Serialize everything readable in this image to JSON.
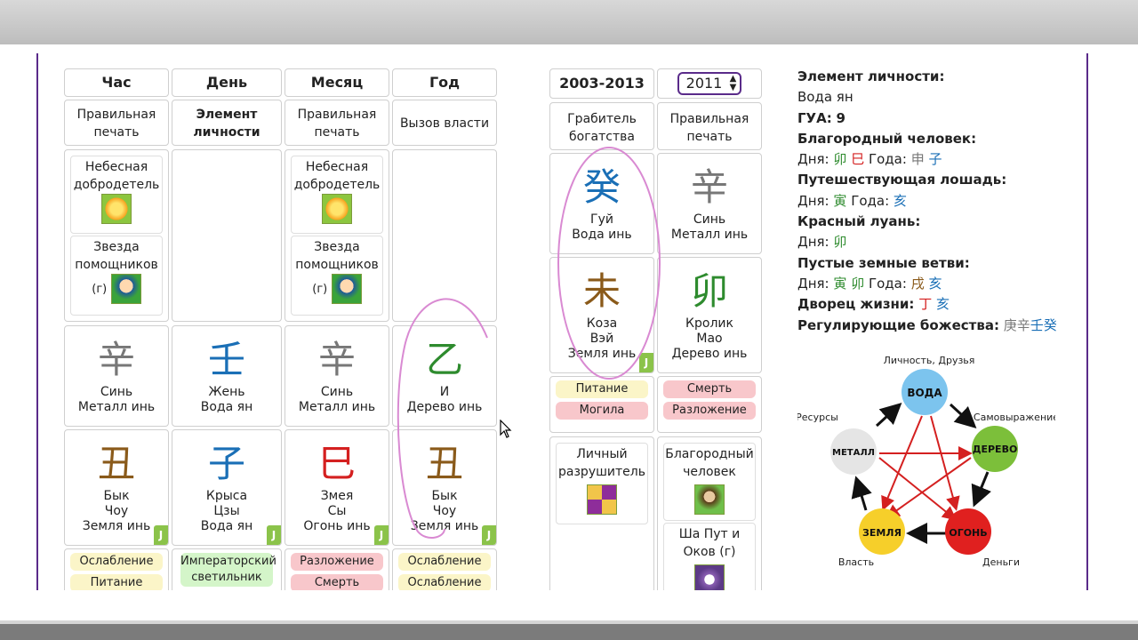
{
  "columns_left": [
    {
      "label": "Час",
      "sub": "Правильная печать",
      "sub_bold": false
    },
    {
      "label": "День",
      "sub": "Элемент личности",
      "sub_bold": true
    },
    {
      "label": "Месяц",
      "sub": "Правильная печать",
      "sub_bold": false
    },
    {
      "label": "Год",
      "sub": "Вызов власти",
      "sub_bold": false
    }
  ],
  "stars": {
    "heavenly": "Небесная добродетель",
    "helpers": "Звезда помощников",
    "helpers_suffix": "(г)"
  },
  "stems": [
    {
      "char": "辛",
      "line1": "Синь",
      "line2": "Металл инь",
      "color": "#777777"
    },
    {
      "char": "壬",
      "line1": "Жень",
      "line2": "Вода ян",
      "color": "#1a6fb6"
    },
    {
      "char": "辛",
      "line1": "Синь",
      "line2": "Металл инь",
      "color": "#777777"
    },
    {
      "char": "乙",
      "line1": "И",
      "line2": "Дерево инь",
      "color": "#2e8b2e"
    }
  ],
  "branches": [
    {
      "char": "丑",
      "line1": "Бык",
      "line2": "Чоу",
      "line3": "Земля инь",
      "color": "#8a5a1a",
      "badge": "J"
    },
    {
      "char": "子",
      "line1": "Крыса",
      "line2": "Цзы",
      "line3": "Вода ян",
      "color": "#1a6fb6",
      "badge": "J"
    },
    {
      "char": "巳",
      "line1": "Змея",
      "line2": "Сы",
      "line3": "Огонь инь",
      "color": "#d42020",
      "badge": "J"
    },
    {
      "char": "丑",
      "line1": "Бык",
      "line2": "Чоу",
      "line3": "Земля инь",
      "color": "#8a5a1a",
      "badge": "J"
    }
  ],
  "bottom_pills": [
    {
      "a": "Ослабление",
      "a_color": "yellow",
      "b": "Питание",
      "b_color": "yellow"
    },
    {
      "a": "Императорский светильник",
      "a_color": "green",
      "b": "",
      "b_color": "green"
    },
    {
      "a": "Разложение",
      "a_color": "pink",
      "b": "Смерть",
      "b_color": "pink"
    },
    {
      "a": "Ослабление",
      "a_color": "yellow",
      "b": "Ослабление",
      "b_color": "yellow"
    }
  ],
  "luck": {
    "decade": "2003-2013",
    "year_selected": "2011",
    "decade_sub": "Грабитель богатства",
    "year_sub": "Правильная печать",
    "decade_stem": {
      "char": "癸",
      "line1": "Гуй",
      "line2": "Вода инь",
      "color": "#1a6fb6"
    },
    "year_stem": {
      "char": "辛",
      "line1": "Синь",
      "line2": "Металл инь",
      "color": "#777777"
    },
    "decade_branch": {
      "char": "未",
      "line1": "Коза",
      "line2": "Вэй",
      "line3": "Земля инь",
      "color": "#8a5a1a",
      "badge": "J"
    },
    "year_branch": {
      "char": "卯",
      "line1": "Кролик",
      "line2": "Мао",
      "line3": "Дерево инь",
      "color": "#2e8b2e"
    },
    "decade_pills": [
      "Питание",
      "Могила"
    ],
    "year_pills": [
      "Смерть",
      "Разложение"
    ],
    "decade_star": "Личный разрушитель",
    "year_star1": "Благородный человек",
    "year_star2": "Ша Пут и Оков (г)"
  },
  "info": {
    "element_label": "Элемент личности:",
    "element_value": "Вода ян",
    "gua_label": "ГУА:",
    "gua_value": "9",
    "noble_label": "Благородный человек:",
    "days_label": "Дня:",
    "years_label": "Года:",
    "noble_days": [
      "卯",
      "巳"
    ],
    "noble_years": [
      "申",
      "子"
    ],
    "horse_label": "Путешествующая лошадь:",
    "horse_days": [
      "寅"
    ],
    "horse_years": [
      "亥"
    ],
    "luan_label": "Красный луань:",
    "luan_days": [
      "卯"
    ],
    "empty_label": "Пустые земные ветви:",
    "empty_days": [
      "寅",
      "卯"
    ],
    "empty_years": [
      "戌",
      "亥"
    ],
    "palace_label": "Дворец жизни:",
    "palace_values": [
      "丁",
      "亥"
    ],
    "deity_label": "Регулирующие божества:",
    "deity_values": [
      "庚",
      "辛",
      "壬",
      "癸"
    ]
  },
  "cycle": {
    "nodes": [
      {
        "label": "ВОДА",
        "color": "#7cc4ee",
        "caption": "Личность, Друзья"
      },
      {
        "label": "ДЕРЕВО",
        "color": "#7cbf3a",
        "caption": "Самовыражение"
      },
      {
        "label": "ОГОНЬ",
        "color": "#e0201f",
        "caption": "Деньги"
      },
      {
        "label": "ЗЕМЛЯ",
        "color": "#f6cf2a",
        "caption": "Власть"
      },
      {
        "label": "МЕТАЛЛ",
        "color": "#e5e5e5",
        "caption": "Ресурсы"
      }
    ]
  }
}
